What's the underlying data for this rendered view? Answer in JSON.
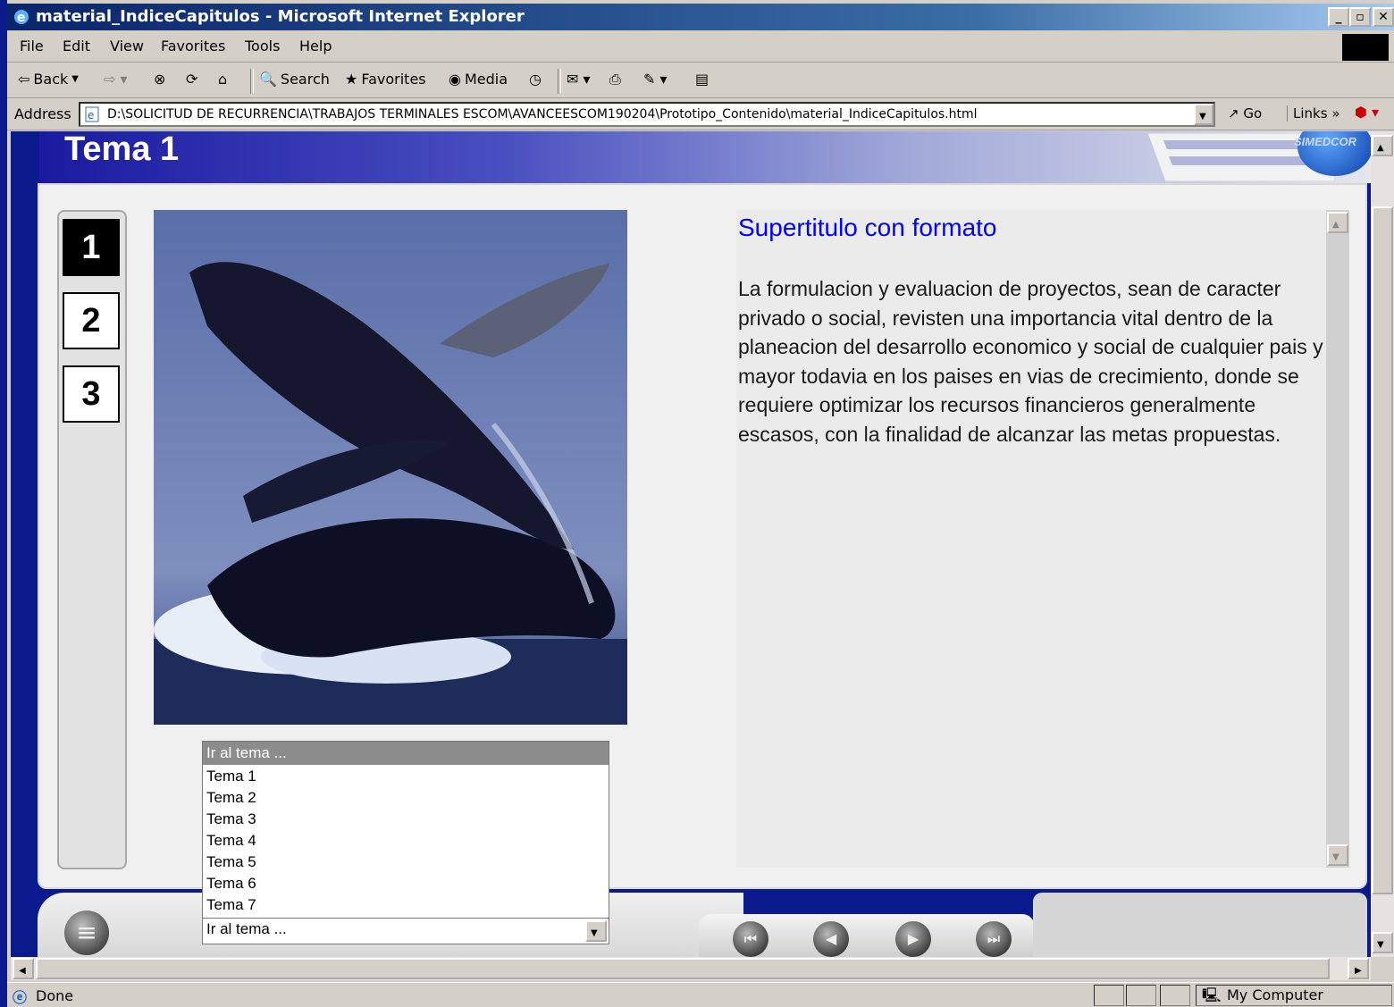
{
  "window": {
    "title": "material_IndiceCapitulos - Microsoft Internet Explorer",
    "min_label": "_",
    "max_label": "▫",
    "close_label": "✕"
  },
  "menu": {
    "items": [
      "File",
      "Edit",
      "View",
      "Favorites",
      "Tools",
      "Help"
    ]
  },
  "toolbar": {
    "back_label": "Back",
    "search_label": "Search",
    "favorites_label": "Favorites",
    "media_label": "Media"
  },
  "address": {
    "label": "Address",
    "url": "D:\\SOLICITUD DE RECURRENCIA\\TRABAJOS TERMINALES ESCOM\\AVANCEESCOM190204\\Prototipo_Contenido\\material_IndiceCapitulos.html",
    "go_label": "Go",
    "links_label": "Links"
  },
  "page": {
    "header_title": "Tema 1",
    "logo_text": "SIMEDCOR",
    "chapters": [
      "1",
      "2",
      "3"
    ],
    "active_chapter": "1",
    "supertitle": "Supertitulo con formato",
    "body": "La formulacion y evaluacion de proyectos, sean de caracter privado o social, revisten una importancia vital dentro de la planeacion del desarrollo economico y social de cualquier pais y mayor todavia en los paises en vias de crecimiento, donde se requiere optimizar los recursos financieros generalmente escasos, con la finalidad de alcanzar las metas propuestas.",
    "topic_select": {
      "placeholder": "Ir al tema ...",
      "options": [
        "Tema 1",
        "Tema 2",
        "Tema 3",
        "Tema 4",
        "Tema 5",
        "Tema 6",
        "Tema 7"
      ],
      "value": "Ir al tema ..."
    }
  },
  "status": {
    "text": "Done",
    "zone": "My Computer"
  },
  "colors": {
    "accent_blue": "#0000ff",
    "header_dark": "#1a1aa0",
    "title_bar": "#0a246a"
  }
}
